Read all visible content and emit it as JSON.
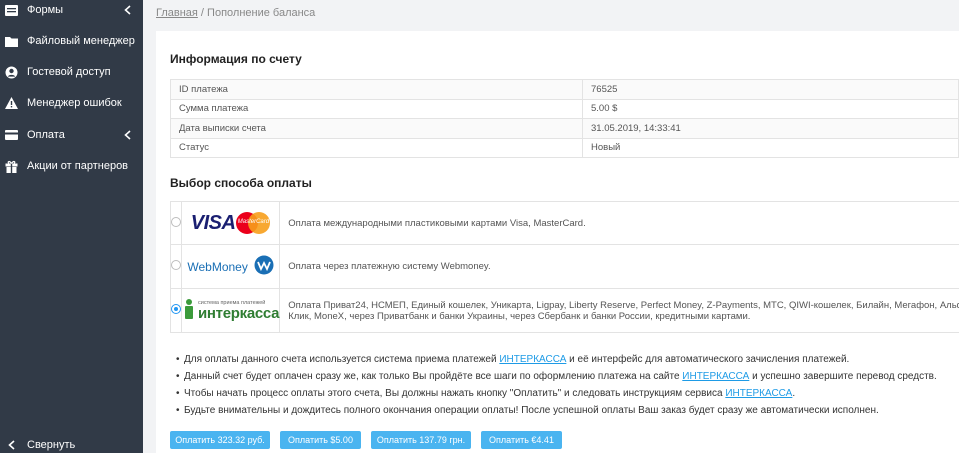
{
  "sidebar": {
    "items": [
      {
        "label": "Формы",
        "icon": "forms-icon",
        "has_chevron": true
      },
      {
        "label": "Файловый менеджер",
        "icon": "file-manager-icon",
        "has_chevron": false
      },
      {
        "label": "Гостевой доступ",
        "icon": "user-circle-icon",
        "has_chevron": false
      },
      {
        "label": "Менеджер ошибок",
        "icon": "warning-icon",
        "has_chevron": false
      },
      {
        "label": "Оплата",
        "icon": "credit-card-icon",
        "has_chevron": true
      },
      {
        "label": "Акции от партнеров",
        "icon": "gift-icon",
        "has_chevron": false
      }
    ],
    "collapse_label": "Свернуть"
  },
  "breadcrumb": {
    "home": "Главная",
    "separator": " / ",
    "current": "Пополнение баланса"
  },
  "account_info": {
    "title": "Информация по счету",
    "rows": [
      {
        "label": "ID платежа",
        "value": "76525"
      },
      {
        "label": "Сумма платежа",
        "value": "5.00 $"
      },
      {
        "label": "Дата выписки счета",
        "value": "31.05.2019, 14:33:41"
      },
      {
        "label": "Статус",
        "value": "Новый"
      }
    ]
  },
  "payment_methods": {
    "title": "Выбор способа оплаты",
    "options": [
      {
        "logo": "VISA",
        "logo_extra": "MasterCard",
        "description": "Оплата международными пластиковыми картами Visa, MasterCard.",
        "selected": false
      },
      {
        "logo": "WebMoney",
        "description": "Оплата через платежную систему Webmoney.",
        "selected": false
      },
      {
        "logo": "интеркасса",
        "logo_caption": "система приема платежей",
        "description_line1": "Оплата Приват24, НСМЕП, Единый кошелек, Уникарта, Ligpay, Liberty Reserve, Perfect Money, Z-Payments, МТС, QIWI-кошелек, Билайн, Мегафон, Альфа-",
        "description_line2": "Клик, MoneX, через Приватбанк и банки Украины, через Сбербанк и банки России, кредитными картами.",
        "selected": true
      }
    ]
  },
  "notes": {
    "n1": {
      "before": "Для оплаты данного счета используется система приема платежей ",
      "link": "ИНТЕРКАССА",
      "after": " и её интерфейс для автоматического зачисления платежей."
    },
    "n2": {
      "before": "Данный счет будет оплачен сразу же, как только Вы пройдёте все шаги по оформлению платежа на сайте ",
      "link": "ИНТЕРКАССА",
      "after": " и успешно завершите перевод средств."
    },
    "n3": {
      "before": "Чтобы начать процесс оплаты этого счета, Вы должны нажать кнопку \"Оплатить\" и следовать инструкциям сервиса ",
      "link": "ИНТЕРКАССА",
      "after": "."
    },
    "n4": {
      "text": "Будьте внимательны и дождитесь полного окончания операции оплаты! После успешной оплаты Ваш заказ будет сразу же автоматически исполнен."
    }
  },
  "buttons": {
    "rub": "Оплатить 323.32 руб.",
    "usd": "Оплатить $5.00",
    "uah": "Оплатить 137.79 грн.",
    "eur": "Оплатить €4.41"
  },
  "colors": {
    "sidebar_bg": "#313a47",
    "accent": "#4ab4f0",
    "link": "#1e9be6",
    "page_bg": "#f2f3f5"
  }
}
